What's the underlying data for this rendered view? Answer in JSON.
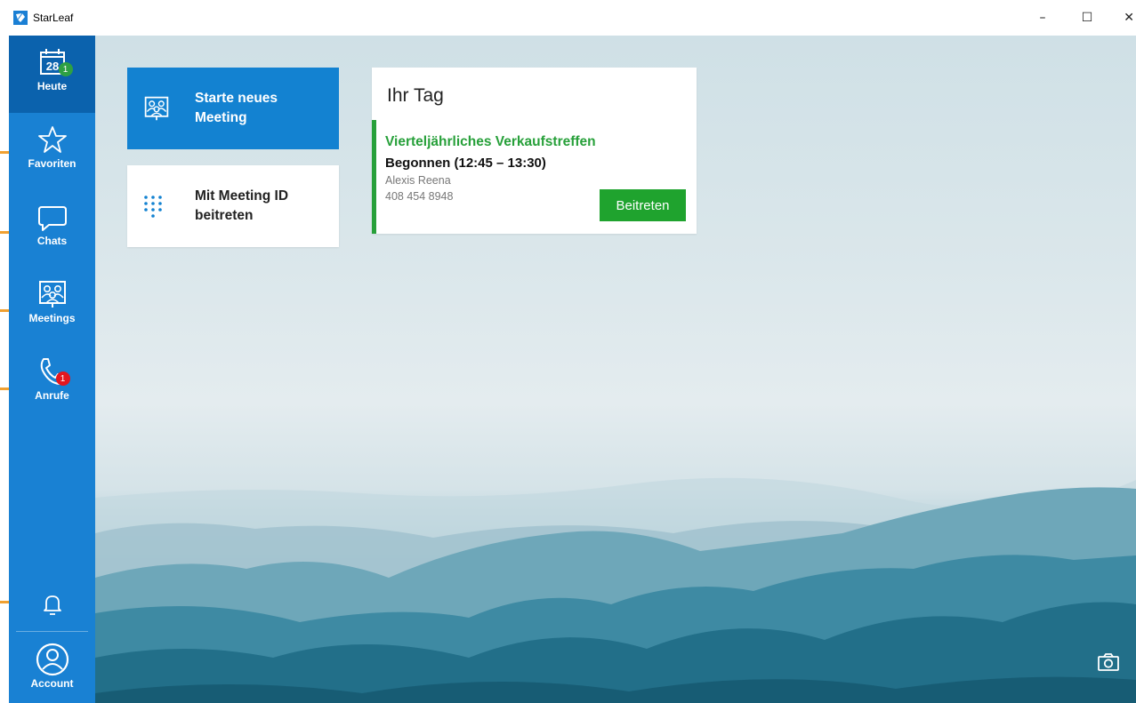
{
  "window": {
    "title": "StarLeaf",
    "minimize_glyph": "–",
    "maximize_glyph": "☐",
    "close_glyph": "✕"
  },
  "sidebar": {
    "items": [
      {
        "label": "Heute",
        "icon": "calendar-icon",
        "icon_text": "28",
        "badge": "1",
        "badge_color": "#2ea043",
        "active": true
      },
      {
        "label": "Favoriten",
        "icon": "star-icon"
      },
      {
        "label": "Chats",
        "icon": "chat-bubble-icon"
      },
      {
        "label": "Meetings",
        "icon": "meeting-group-icon"
      },
      {
        "label": "Anrufe",
        "icon": "phone-icon",
        "badge": "1",
        "badge_color": "#e3171f"
      }
    ],
    "bottom": [
      {
        "label": "",
        "icon": "bell-icon"
      },
      {
        "label": "Account",
        "icon": "account-icon"
      }
    ]
  },
  "actions": {
    "start_meeting": "Starte neues Meeting",
    "join_by_id": "Mit Meeting ID beitreten"
  },
  "day_panel": {
    "title": "Ihr Tag",
    "meeting": {
      "title": "Vierteljährliches Verkaufstreffen",
      "status": "Begonnen (12:45 – 13:30)",
      "host": "Alexis Reena",
      "phone": "408 454 8948",
      "join_label": "Beitreten",
      "accent_color": "#27a03a"
    }
  },
  "colors": {
    "sidebar": "#1981d3",
    "sidebar_active": "#0b62ad",
    "primary_card": "#1382d1",
    "join_button": "#1fa32e"
  },
  "misc": {
    "camera_icon": "camera-icon"
  }
}
